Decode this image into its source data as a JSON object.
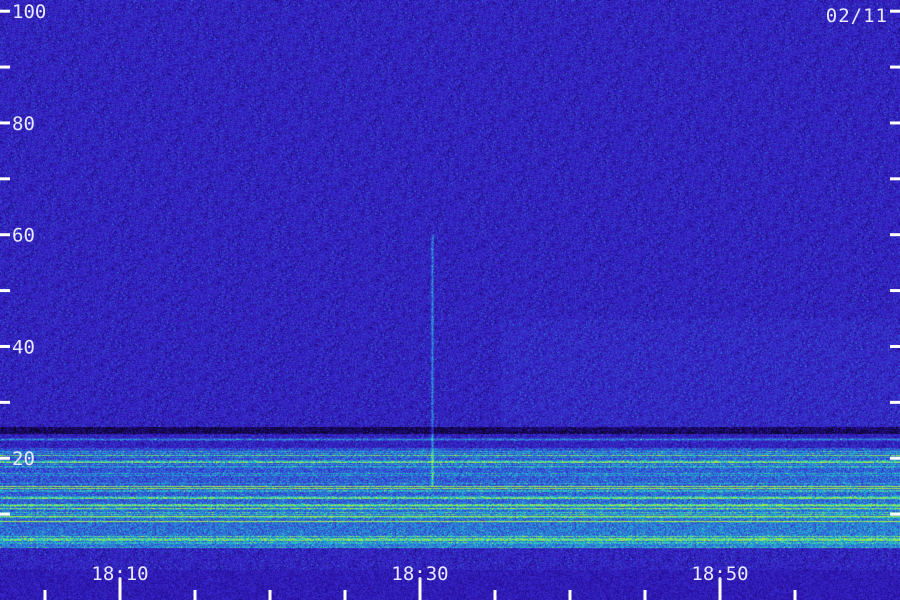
{
  "chart_data": {
    "type": "heatmap",
    "title": "",
    "date_label": "02/11",
    "xlabel": "",
    "ylabel": "",
    "x_tick_labels": [
      "18:10",
      "18:30",
      "18:50"
    ],
    "x_range": [
      "18:02",
      "18:62"
    ],
    "x_major_ticks_minutes": [
      10,
      30,
      50
    ],
    "x_minor_ticks_minutes": [
      5,
      15,
      20,
      25,
      35,
      40,
      45,
      55
    ],
    "y_tick_labels": [
      "20",
      "40",
      "60",
      "80",
      "100"
    ],
    "y_tick_values": [
      20,
      40,
      60,
      80,
      100
    ],
    "y_minor_tick_values": [
      10,
      30,
      50,
      70,
      90
    ],
    "ylim": [
      0,
      102
    ],
    "colormap": [
      "#0a0428",
      "#2a0fa8",
      "#3a2fd0",
      "#2a7ad8",
      "#22c8c8",
      "#a8f040"
    ],
    "features": [
      {
        "kind": "vertical_burst",
        "time_minute": 30.8,
        "y_range": [
          15,
          60
        ]
      },
      {
        "kind": "strong_band",
        "y_range": [
          4,
          22
        ]
      },
      {
        "kind": "dark_band",
        "y": 25
      },
      {
        "kind": "line",
        "y": 23.5
      },
      {
        "kind": "line",
        "y": 13
      },
      {
        "kind": "line",
        "y": 19.5
      }
    ]
  },
  "colors": {
    "tick": "#ffffff",
    "label": "#e8e8ff",
    "background": "#1e0d78"
  }
}
